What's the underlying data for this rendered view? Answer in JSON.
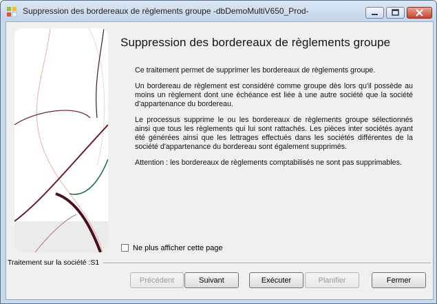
{
  "window": {
    "title": "Suppression des bordereaux de règlements groupe -dbDemoMultiV650_Prod-"
  },
  "page": {
    "heading": "Suppression des bordereaux de règlements groupe",
    "paragraphs": [
      "Ce traitement permet de supprimer les bordereaux de règlements groupe.",
      "Un bordereau de règlement est considéré comme groupe dès lors qu'il possède au moins un règlement dont une échéance est liée à une autre société que la société d'appartenance du bordereau.",
      "Le processus supprime le ou les bordereaux de règlements groupe sélectionnés ainsi que tous les règlements qui lui sont rattachés. Les pièces inter sociétés ayant été générées ainsi que les lettrages effectués dans les sociétés différentes de la société d'appartenance du bordereau sont également supprimés.",
      "Attention : les bordereaux de règlements comptabilisés ne sont pas supprimables."
    ],
    "checkbox_label": "Ne plus afficher cette page",
    "checkbox_checked": false
  },
  "status": {
    "text": "Traitement sur la société :S1"
  },
  "buttons": {
    "previous": "Précédent",
    "next": "Suivant",
    "execute": "Exécuter",
    "schedule": "Planifier",
    "close": "Fermer"
  }
}
